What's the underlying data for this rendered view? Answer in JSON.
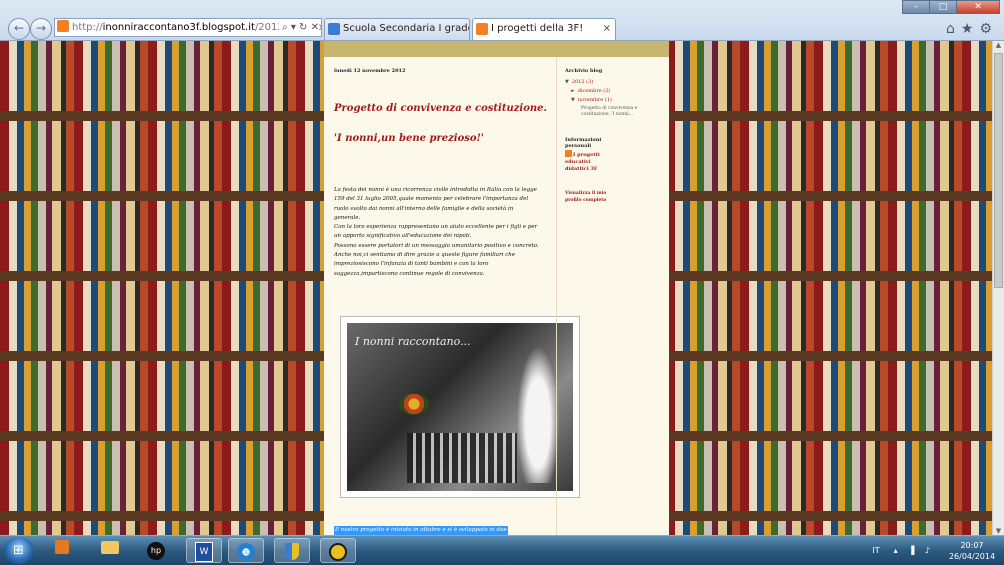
{
  "browser": {
    "address_prefix": "http://",
    "address_host": "inonniraccontano3f.blogspot.it",
    "address_path": "/2012/11/i-nonn",
    "address_tools": "⌕ ▾ ↻ ✕",
    "tabs": [
      {
        "title": "Scuola Secondaria I grado \"Nic...",
        "active": false
      },
      {
        "title": "I progetti della 3F!",
        "active": true
      }
    ],
    "window_controls": {
      "minimize": "–",
      "maximize": "□",
      "close": "✕"
    },
    "toolbar_icons": "⌂★⚙"
  },
  "post": {
    "date": "lunedì 12 novembre 2012",
    "title": "Progetto di convivenza e costituzione.",
    "subtitle": "'I nonni,un bene prezioso!'",
    "paragraphs": [
      "La festa dei nonni è una ricorrenza civile introdotta in Italia con la legge 159 del 31 luglio 2005,quale momento per celebrare l'importanza del ruolo svolto dai nonni all'interno delle famiglie e della società in generale.",
      "Con la loro esperienza rappresentano un aiuto eccellente per i figli e per un apporto significativo all'educazione dei nipoti.",
      "Possono essere portatori di un messaggio umanitario positivo e concreto.",
      "Anche noi,ci sentiamo di dire grazie a queste figure familiari che impreziosiscono l'infanzia di tanti bambini e con la loro saggezza,impartiscono continue regole di convivenza."
    ],
    "photo_caption": "I nonni raccontano...",
    "selected_text": "Il nostro progetto è iniziato in ottobre e si è sviluppato in due"
  },
  "sidebar": {
    "archive_heading": "Archivio blog",
    "archive": [
      {
        "toggle": "▼",
        "label": "2012 (3)"
      },
      {
        "toggle": "►",
        "label": "dicembre (2)"
      },
      {
        "toggle": "▼",
        "label": "novembre (1)"
      }
    ],
    "archive_post": "Progetto di convivenza e costituzione. 'I nonni...",
    "profile_heading": "Informazioni personali",
    "profile_name": "I progetti educativi didattici 3F",
    "profile_link_text": "Visualizza il mio profilo completo"
  },
  "taskbar": {
    "start_glyph": "⊞",
    "hp_label": "hp",
    "word_label": "W",
    "ie_label": "e",
    "language": "IT",
    "tray_icons": "▴ ▐ ♪",
    "time": "20:07",
    "date": "26/04/2014"
  },
  "colors": {
    "title_red": "#a01a1a",
    "column_bg": "#fdf9ea",
    "header_band": "#c9b66e",
    "selection": "#3399ff"
  }
}
